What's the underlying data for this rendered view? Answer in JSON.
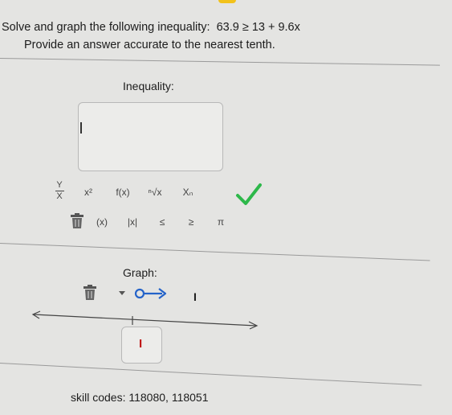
{
  "problem": {
    "prompt": "Solve and graph the following inequality:",
    "inequality": "63.9 ≥ 13 + 9.6x",
    "instruction": "Provide an answer accurate to the nearest tenth."
  },
  "inequality_section": {
    "label": "Inequality:",
    "answer_value": ""
  },
  "toolbar_row1": [
    {
      "name": "fraction-tool",
      "label": "Y/X"
    },
    {
      "name": "exponent-tool",
      "label": "x²"
    },
    {
      "name": "function-tool",
      "label": "f(x)"
    },
    {
      "name": "root-tool",
      "label": "ⁿ√x"
    },
    {
      "name": "subscript-tool",
      "label": "Xₙ"
    }
  ],
  "toolbar_row2": [
    {
      "name": "parentheses-tool",
      "label": "(x)"
    },
    {
      "name": "absolute-value-tool",
      "label": "|x|"
    },
    {
      "name": "less-equal-tool",
      "label": "≤"
    },
    {
      "name": "greater-equal-tool",
      "label": "≥"
    },
    {
      "name": "pi-tool",
      "label": "π"
    }
  ],
  "graph_section": {
    "label": "Graph:",
    "cursor_mark": "I",
    "point_value": "I"
  },
  "footer": {
    "skill_codes": "skill codes: 118080, 118051"
  },
  "colors": {
    "check": "#2db84a",
    "accent": "#2463c9",
    "flag": "#f2c21b"
  }
}
